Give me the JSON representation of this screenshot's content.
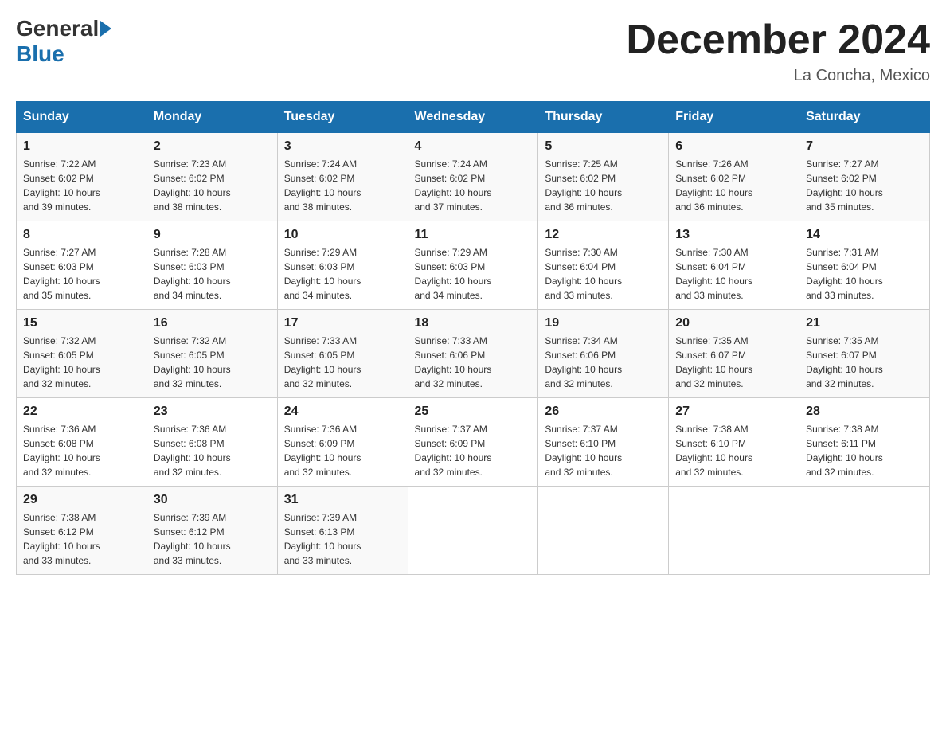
{
  "header": {
    "title": "December 2024",
    "location": "La Concha, Mexico",
    "logo_general": "General",
    "logo_blue": "Blue"
  },
  "days_of_week": [
    "Sunday",
    "Monday",
    "Tuesday",
    "Wednesday",
    "Thursday",
    "Friday",
    "Saturday"
  ],
  "weeks": [
    [
      {
        "day": "1",
        "sunrise": "7:22 AM",
        "sunset": "6:02 PM",
        "daylight": "10 hours and 39 minutes."
      },
      {
        "day": "2",
        "sunrise": "7:23 AM",
        "sunset": "6:02 PM",
        "daylight": "10 hours and 38 minutes."
      },
      {
        "day": "3",
        "sunrise": "7:24 AM",
        "sunset": "6:02 PM",
        "daylight": "10 hours and 38 minutes."
      },
      {
        "day": "4",
        "sunrise": "7:24 AM",
        "sunset": "6:02 PM",
        "daylight": "10 hours and 37 minutes."
      },
      {
        "day": "5",
        "sunrise": "7:25 AM",
        "sunset": "6:02 PM",
        "daylight": "10 hours and 36 minutes."
      },
      {
        "day": "6",
        "sunrise": "7:26 AM",
        "sunset": "6:02 PM",
        "daylight": "10 hours and 36 minutes."
      },
      {
        "day": "7",
        "sunrise": "7:27 AM",
        "sunset": "6:02 PM",
        "daylight": "10 hours and 35 minutes."
      }
    ],
    [
      {
        "day": "8",
        "sunrise": "7:27 AM",
        "sunset": "6:03 PM",
        "daylight": "10 hours and 35 minutes."
      },
      {
        "day": "9",
        "sunrise": "7:28 AM",
        "sunset": "6:03 PM",
        "daylight": "10 hours and 34 minutes."
      },
      {
        "day": "10",
        "sunrise": "7:29 AM",
        "sunset": "6:03 PM",
        "daylight": "10 hours and 34 minutes."
      },
      {
        "day": "11",
        "sunrise": "7:29 AM",
        "sunset": "6:03 PM",
        "daylight": "10 hours and 34 minutes."
      },
      {
        "day": "12",
        "sunrise": "7:30 AM",
        "sunset": "6:04 PM",
        "daylight": "10 hours and 33 minutes."
      },
      {
        "day": "13",
        "sunrise": "7:30 AM",
        "sunset": "6:04 PM",
        "daylight": "10 hours and 33 minutes."
      },
      {
        "day": "14",
        "sunrise": "7:31 AM",
        "sunset": "6:04 PM",
        "daylight": "10 hours and 33 minutes."
      }
    ],
    [
      {
        "day": "15",
        "sunrise": "7:32 AM",
        "sunset": "6:05 PM",
        "daylight": "10 hours and 32 minutes."
      },
      {
        "day": "16",
        "sunrise": "7:32 AM",
        "sunset": "6:05 PM",
        "daylight": "10 hours and 32 minutes."
      },
      {
        "day": "17",
        "sunrise": "7:33 AM",
        "sunset": "6:05 PM",
        "daylight": "10 hours and 32 minutes."
      },
      {
        "day": "18",
        "sunrise": "7:33 AM",
        "sunset": "6:06 PM",
        "daylight": "10 hours and 32 minutes."
      },
      {
        "day": "19",
        "sunrise": "7:34 AM",
        "sunset": "6:06 PM",
        "daylight": "10 hours and 32 minutes."
      },
      {
        "day": "20",
        "sunrise": "7:35 AM",
        "sunset": "6:07 PM",
        "daylight": "10 hours and 32 minutes."
      },
      {
        "day": "21",
        "sunrise": "7:35 AM",
        "sunset": "6:07 PM",
        "daylight": "10 hours and 32 minutes."
      }
    ],
    [
      {
        "day": "22",
        "sunrise": "7:36 AM",
        "sunset": "6:08 PM",
        "daylight": "10 hours and 32 minutes."
      },
      {
        "day": "23",
        "sunrise": "7:36 AM",
        "sunset": "6:08 PM",
        "daylight": "10 hours and 32 minutes."
      },
      {
        "day": "24",
        "sunrise": "7:36 AM",
        "sunset": "6:09 PM",
        "daylight": "10 hours and 32 minutes."
      },
      {
        "day": "25",
        "sunrise": "7:37 AM",
        "sunset": "6:09 PM",
        "daylight": "10 hours and 32 minutes."
      },
      {
        "day": "26",
        "sunrise": "7:37 AM",
        "sunset": "6:10 PM",
        "daylight": "10 hours and 32 minutes."
      },
      {
        "day": "27",
        "sunrise": "7:38 AM",
        "sunset": "6:10 PM",
        "daylight": "10 hours and 32 minutes."
      },
      {
        "day": "28",
        "sunrise": "7:38 AM",
        "sunset": "6:11 PM",
        "daylight": "10 hours and 32 minutes."
      }
    ],
    [
      {
        "day": "29",
        "sunrise": "7:38 AM",
        "sunset": "6:12 PM",
        "daylight": "10 hours and 33 minutes."
      },
      {
        "day": "30",
        "sunrise": "7:39 AM",
        "sunset": "6:12 PM",
        "daylight": "10 hours and 33 minutes."
      },
      {
        "day": "31",
        "sunrise": "7:39 AM",
        "sunset": "6:13 PM",
        "daylight": "10 hours and 33 minutes."
      },
      null,
      null,
      null,
      null
    ]
  ],
  "labels": {
    "sunrise": "Sunrise:",
    "sunset": "Sunset:",
    "daylight": "Daylight:"
  }
}
